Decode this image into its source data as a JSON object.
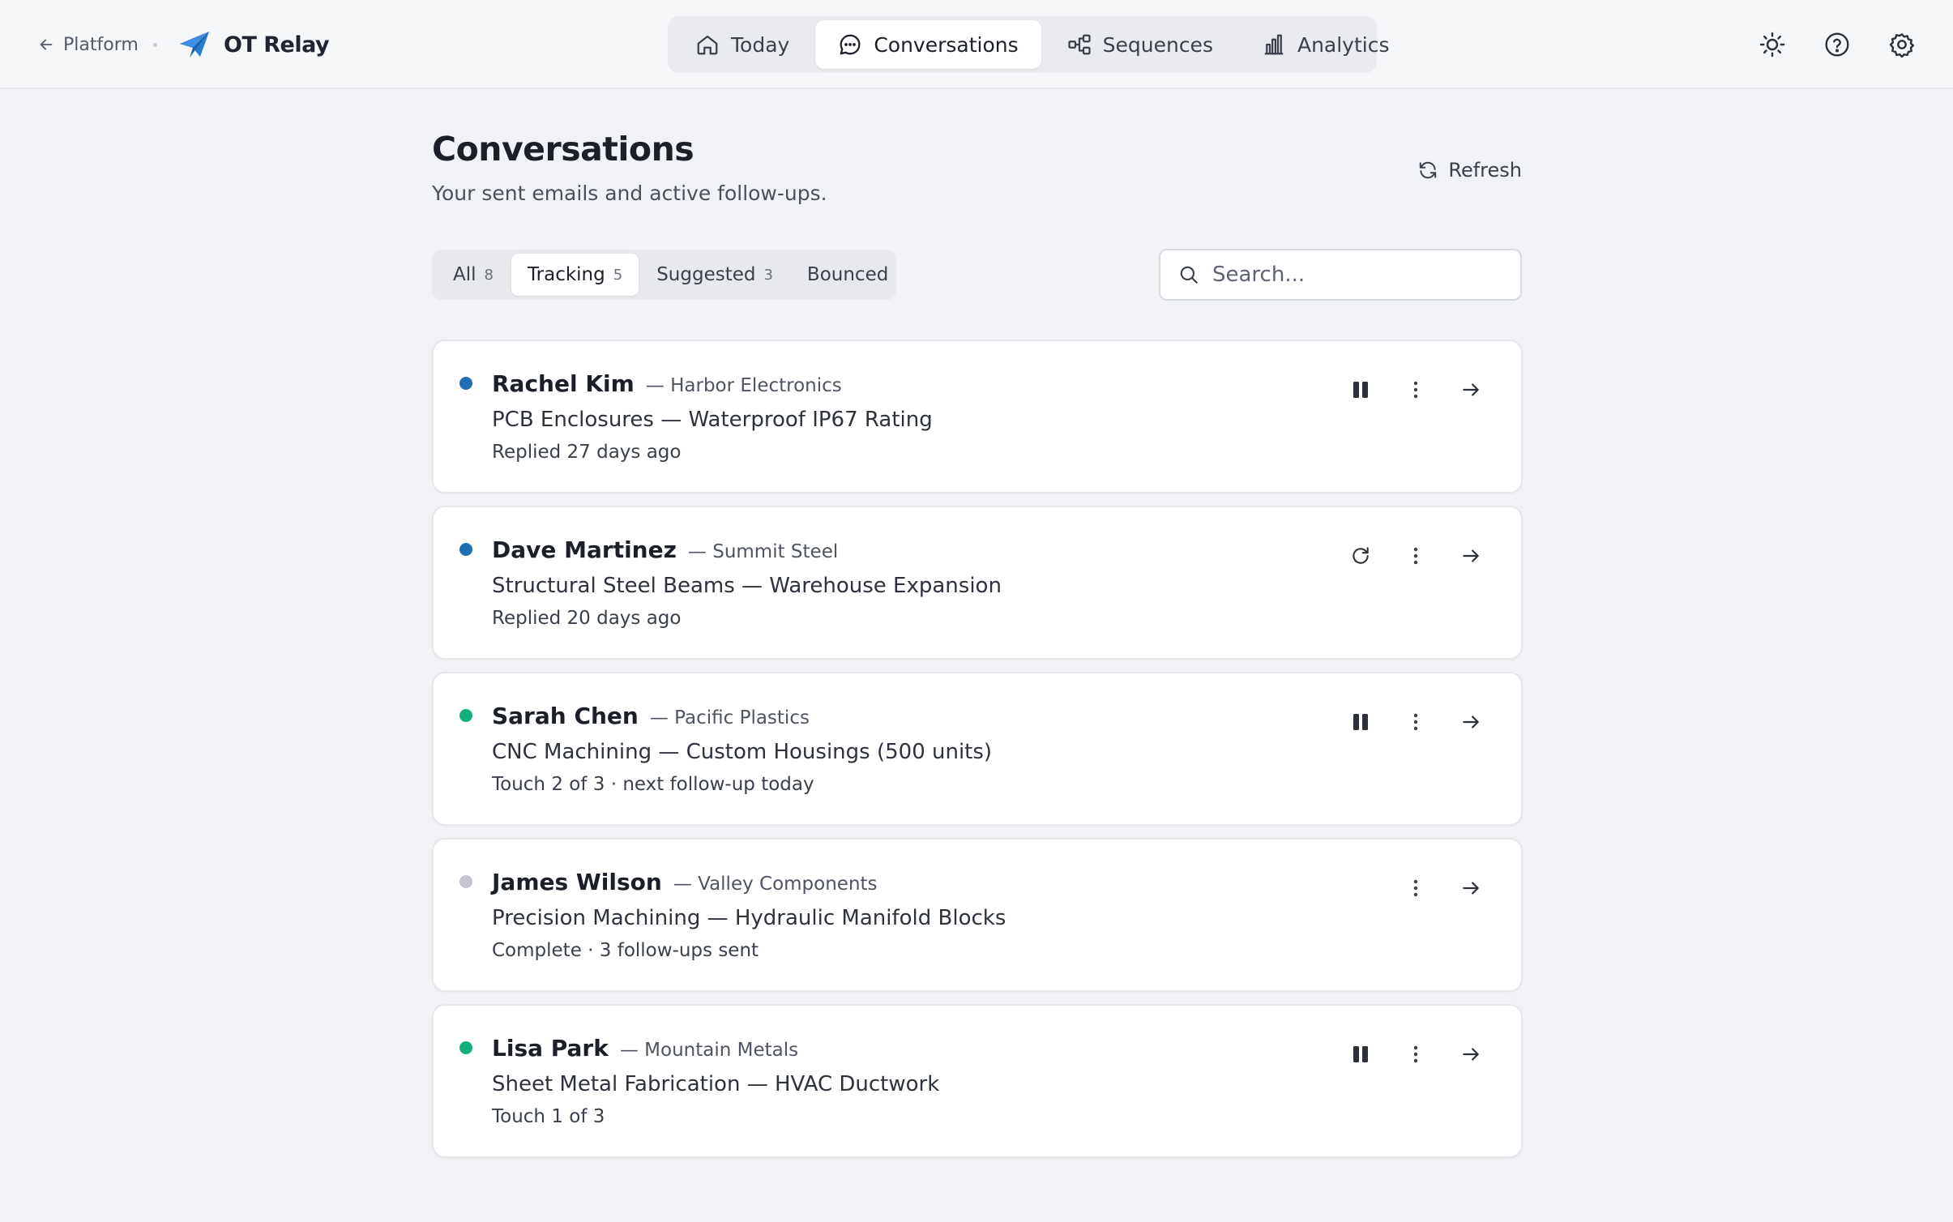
{
  "topbar": {
    "back_label": "Platform",
    "brand": "OT Relay",
    "nav": [
      {
        "label": "Today",
        "icon": "home-icon",
        "active": false
      },
      {
        "label": "Conversations",
        "icon": "chat-icon",
        "active": true
      },
      {
        "label": "Sequences",
        "icon": "sequences-icon",
        "active": false
      },
      {
        "label": "Analytics",
        "icon": "bar-chart-icon",
        "active": false
      }
    ],
    "right_icons": [
      "sun-icon",
      "help-icon",
      "gear-icon"
    ]
  },
  "page": {
    "title": "Conversations",
    "subtitle": "Your sent emails and active follow-ups.",
    "refresh_label": "Refresh"
  },
  "filters": [
    {
      "label": "All",
      "count": "8",
      "active": false
    },
    {
      "label": "Tracking",
      "count": "5",
      "active": true
    },
    {
      "label": "Suggested",
      "count": "3",
      "active": false
    },
    {
      "label": "Bounced",
      "count": "",
      "active": false
    }
  ],
  "search": {
    "placeholder": "Search...",
    "value": ""
  },
  "conversations": [
    {
      "name": "Rachel Kim",
      "company": "— Harbor Electronics",
      "subject": "PCB Enclosures — Waterproof IP67 Rating",
      "status": "Replied 27 days ago",
      "dot_color": "#1f6fb5",
      "primary_action": "pause"
    },
    {
      "name": "Dave Martinez",
      "company": "— Summit Steel",
      "subject": "Structural Steel Beams — Warehouse Expansion",
      "status": "Replied 20 days ago",
      "dot_color": "#1f6fb5",
      "primary_action": "resume"
    },
    {
      "name": "Sarah Chen",
      "company": "— Pacific Plastics",
      "subject": "CNC Machining — Custom Housings (500 units)",
      "status": "Touch 2 of 3 · next follow-up today",
      "dot_color": "#12b07a",
      "primary_action": "pause"
    },
    {
      "name": "James Wilson",
      "company": "— Valley Components",
      "subject": "Precision Machining — Hydraulic Manifold Blocks",
      "status": "Complete · 3 follow-ups sent",
      "dot_color": "#c4c7cd",
      "primary_action": "none"
    },
    {
      "name": "Lisa Park",
      "company": "— Mountain Metals",
      "subject": "Sheet Metal Fabrication — HVAC Ductwork",
      "status": "Touch 1 of 3",
      "dot_color": "#12b07a",
      "primary_action": "pause"
    }
  ]
}
